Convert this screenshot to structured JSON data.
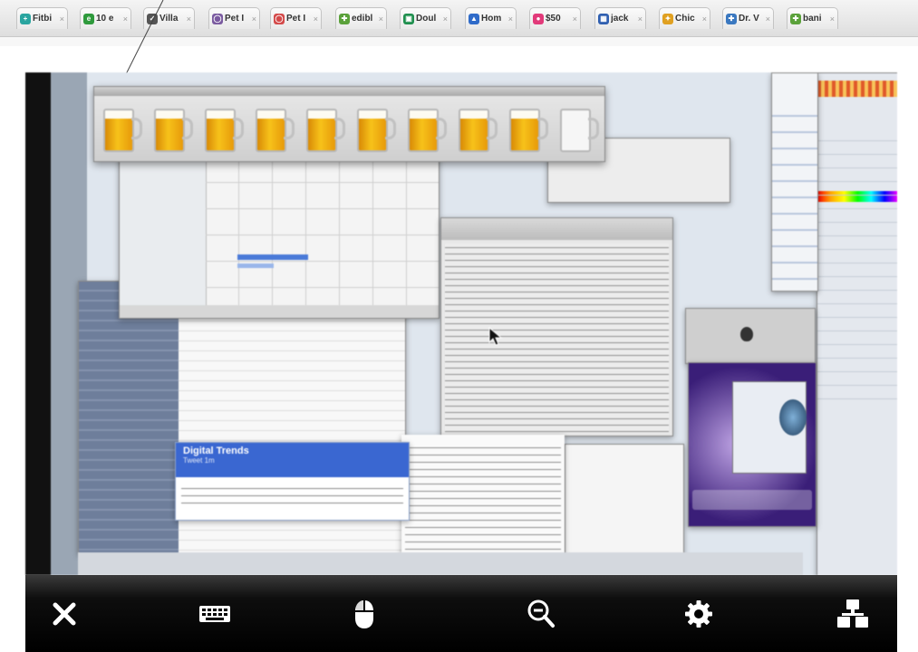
{
  "tabs": [
    {
      "label": "Fitbi",
      "icon": "fitbit-icon",
      "color": "#2aa5a0"
    },
    {
      "label": "10 e",
      "icon": "circle-e-icon",
      "color": "#2e9a3c"
    },
    {
      "label": "Villa",
      "icon": "checkmark-icon",
      "color": "#555555"
    },
    {
      "label": "Pet I",
      "icon": "pet-outline-icon",
      "color": "#7a5aa0"
    },
    {
      "label": "Pet I",
      "icon": "pet-outline-icon",
      "color": "#d44a4a"
    },
    {
      "label": "edibl",
      "icon": "puzzle-icon",
      "color": "#5aa13a"
    },
    {
      "label": "Doul",
      "icon": "doc-green-icon",
      "color": "#1f8f4e"
    },
    {
      "label": "Hom",
      "icon": "house-icon",
      "color": "#2f6bc9"
    },
    {
      "label": "$50",
      "icon": "speech-bubble-icon",
      "color": "#e23a7a"
    },
    {
      "label": "jack",
      "icon": "calendar-icon",
      "color": "#2f5fb0"
    },
    {
      "label": "Chic",
      "icon": "chick-icon",
      "color": "#e0a020"
    },
    {
      "label": "Dr. V",
      "icon": "doctor-icon",
      "color": "#3a78c0"
    },
    {
      "label": "bani",
      "icon": "puzzle-icon",
      "color": "#5aa13a"
    }
  ],
  "tab_close": "×",
  "remote_screen": {
    "beer_mugs": [
      {
        "level": 1.0
      },
      {
        "level": 1.0
      },
      {
        "level": 1.0
      },
      {
        "level": 1.0
      },
      {
        "level": 1.0
      },
      {
        "level": 1.0
      },
      {
        "level": 1.0
      },
      {
        "level": 1.0
      },
      {
        "level": 1.0
      },
      {
        "level": 0.0
      }
    ],
    "notification": {
      "title": "Digital Trends",
      "subtitle": "Tweet 1m"
    }
  },
  "toolbar": [
    {
      "name": "close-button",
      "icon": "close-icon"
    },
    {
      "name": "keyboard-button",
      "icon": "keyboard-icon"
    },
    {
      "name": "mouse-button",
      "icon": "mouse-icon"
    },
    {
      "name": "zoom-out-button",
      "icon": "zoom-out-icon"
    },
    {
      "name": "settings-button",
      "icon": "gear-icon"
    },
    {
      "name": "screens-button",
      "icon": "network-icon"
    }
  ],
  "colors": {
    "toolbar_bg": "#000000",
    "tab_bg": "#efefef",
    "notification_blue": "#3a67d1",
    "beer": "#f2b310"
  }
}
